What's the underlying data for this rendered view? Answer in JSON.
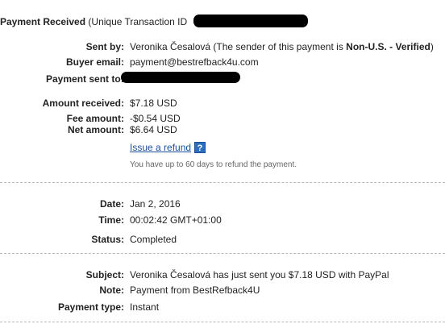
{
  "header": {
    "title_bold": "Payment Received",
    "title_rest": "(Unique Transaction ID"
  },
  "sender": {
    "sent_by_label": "Sent by:",
    "sent_by_name": "Veronika Česalová",
    "sent_by_note_prefix": "(The sender of this payment is",
    "sent_by_status": "Non-U.S. - Verified",
    "sent_by_note_suffix": ")",
    "buyer_email_label": "Buyer email:",
    "buyer_email_value": "payment@bestrefback4u.com",
    "payment_sent_to_label": "Payment sent to:"
  },
  "amounts": {
    "received_label": "Amount received:",
    "received_value": "$7.18 USD",
    "fee_label": "Fee amount:",
    "fee_value": "-$0.54 USD",
    "net_label": "Net amount:",
    "net_value": "$6.64 USD",
    "refund_link": "Issue a refund",
    "help_icon": "?",
    "refund_note": "You have up to 60 days to refund the payment."
  },
  "details": {
    "date_label": "Date:",
    "date_value": "Jan 2, 2016",
    "time_label": "Time:",
    "time_value": "00:02:42 GMT+01:00",
    "status_label": "Status:",
    "status_value": "Completed"
  },
  "message": {
    "subject_label": "Subject:",
    "subject_value": "Veronika Česalová has just sent you $7.18 USD with PayPal",
    "note_label": "Note:",
    "note_value": "Payment from BestRefback4U",
    "payment_type_label": "Payment type:",
    "payment_type_value": "Instant"
  },
  "colors": {
    "link": "#1a4fa0",
    "help_icon_bg": "#2d6fbf",
    "redaction": "#000000"
  }
}
